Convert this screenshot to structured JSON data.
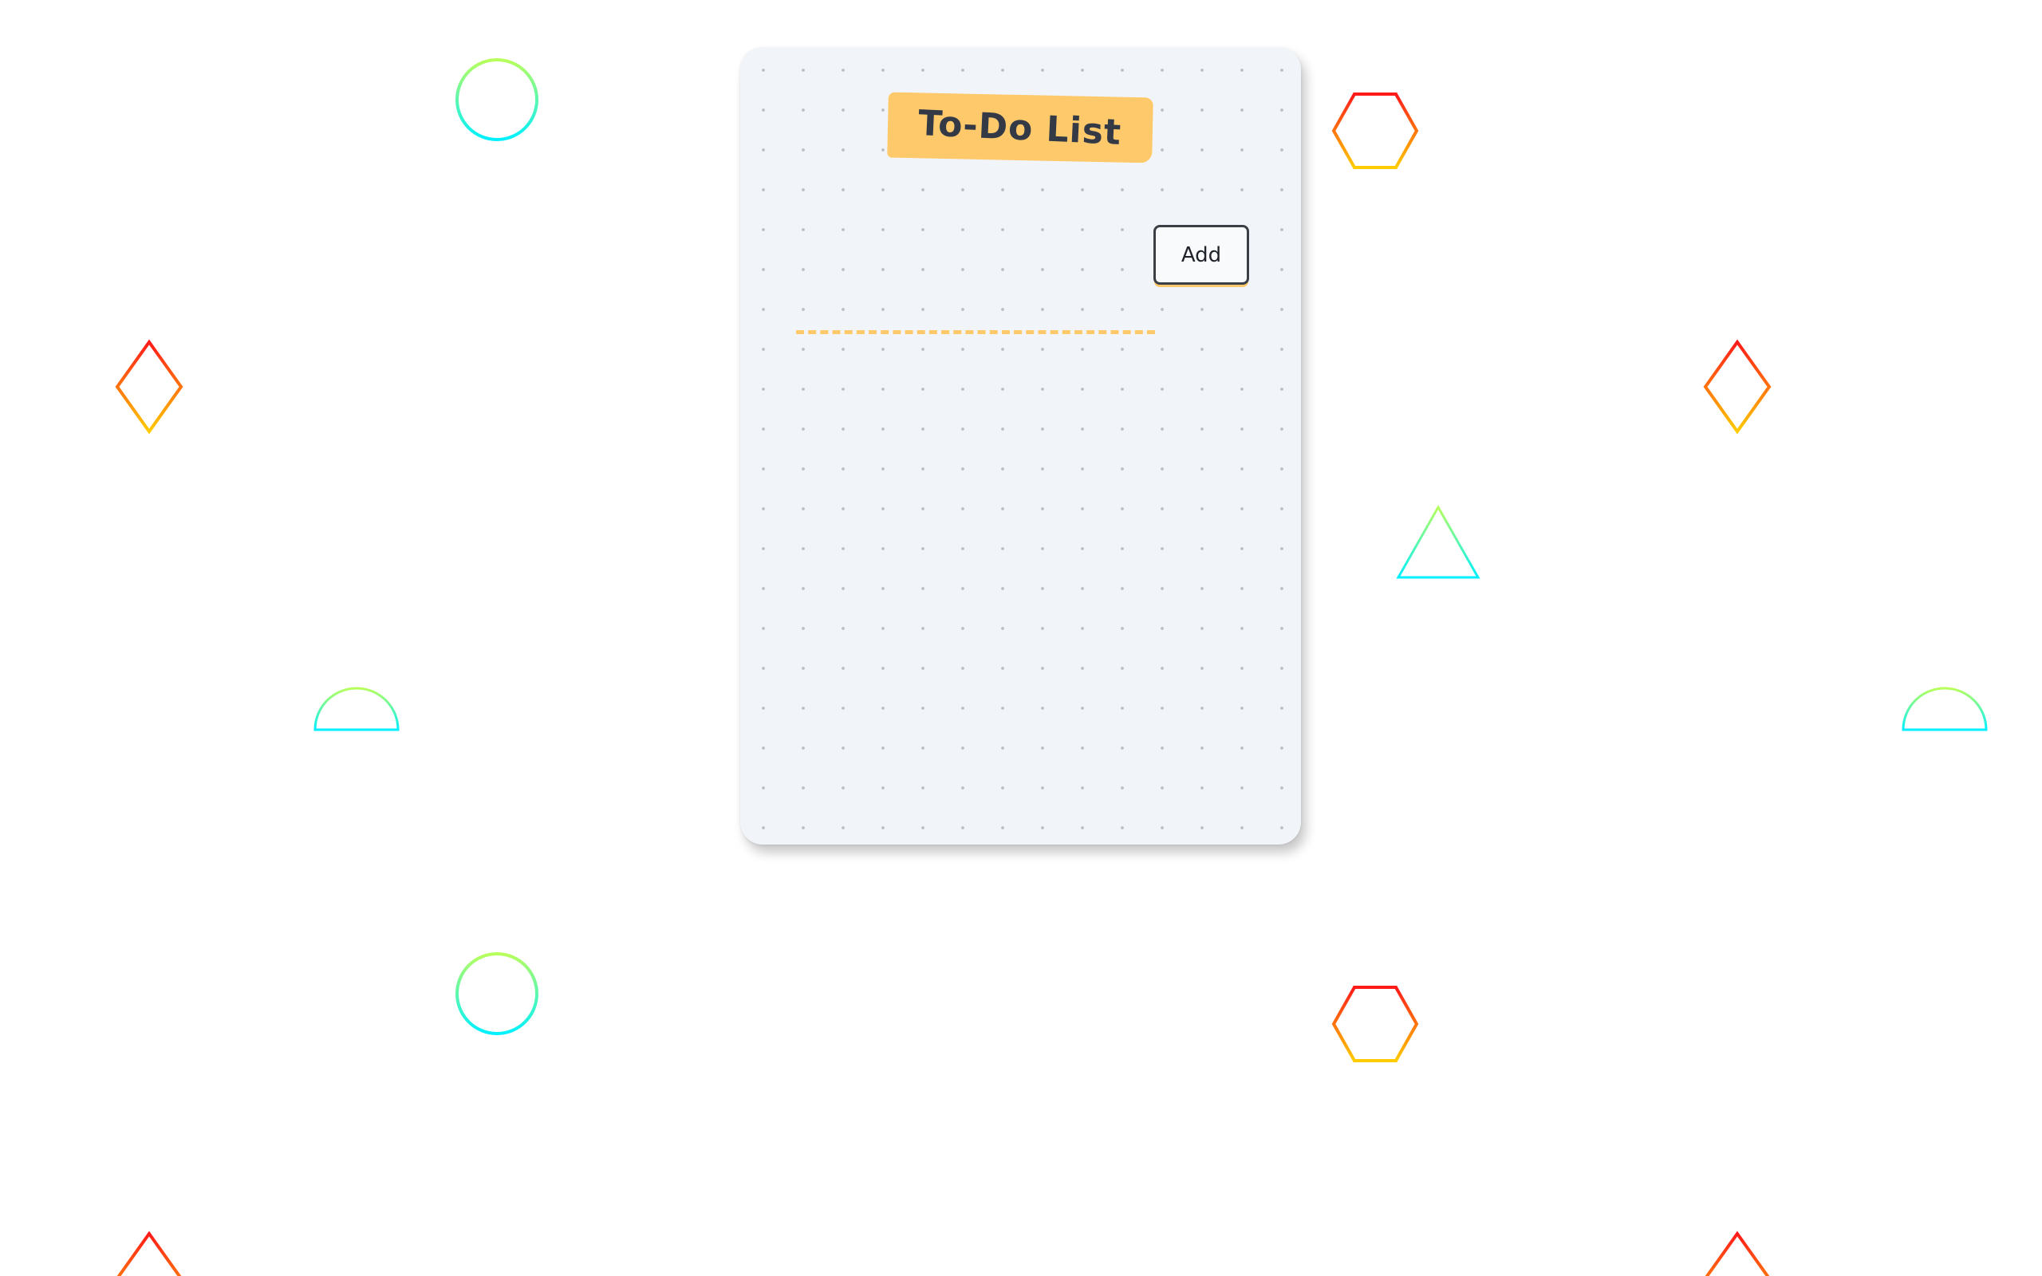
{
  "app": {
    "title": "To-Do List"
  },
  "form": {
    "input_value": "",
    "input_placeholder": "",
    "add_label": "Add"
  },
  "tasks": [],
  "colors": {
    "card_background": "#f1f5f9",
    "dot_grid": "#b8bfc8",
    "accent_yellow": "#fec96b",
    "text_dark": "#333a45",
    "warm_gradient": [
      "#ff1a1a",
      "#ffcc00"
    ],
    "cool_gradient": [
      "#b8ff5c",
      "#00f0ff"
    ]
  },
  "decorations": [
    {
      "shape": "circle",
      "gradient": "cool"
    },
    {
      "shape": "circle",
      "gradient": "cool"
    },
    {
      "shape": "hexagon",
      "gradient": "warm"
    },
    {
      "shape": "hexagon",
      "gradient": "warm"
    },
    {
      "shape": "diamond",
      "gradient": "warm"
    },
    {
      "shape": "diamond",
      "gradient": "warm"
    },
    {
      "shape": "diamond",
      "gradient": "warm"
    },
    {
      "shape": "diamond",
      "gradient": "warm"
    },
    {
      "shape": "triangle",
      "gradient": "cool"
    },
    {
      "shape": "semicircle",
      "gradient": "cool"
    },
    {
      "shape": "semicircle",
      "gradient": "cool"
    }
  ]
}
